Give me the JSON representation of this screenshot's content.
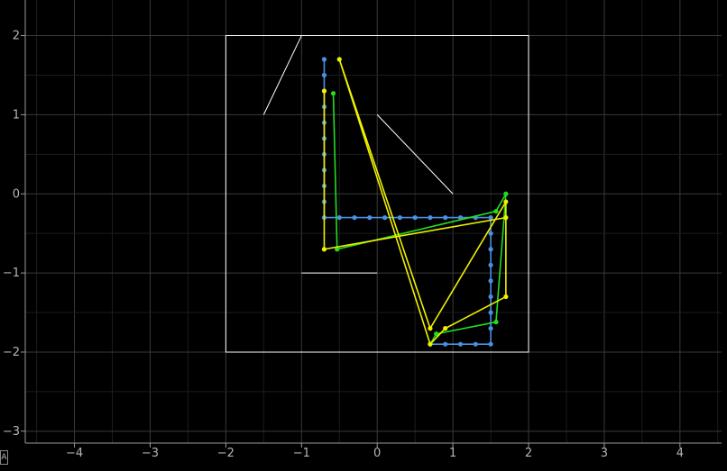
{
  "chart_data": {
    "type": "scatter",
    "title": "",
    "xlabel": "",
    "ylabel": "",
    "xlim": [
      -4.65,
      4.55
    ],
    "ylim": [
      -3.15,
      2.45
    ],
    "grid": true,
    "x_ticks": [
      -4,
      -3,
      -2,
      -1,
      0,
      1,
      2,
      3,
      4
    ],
    "y_ticks": [
      -3,
      -2,
      -1,
      0,
      1,
      2
    ],
    "x_tick_labels": [
      "−4",
      "−3",
      "−2",
      "−1",
      "0",
      "1",
      "2",
      "3",
      "4"
    ],
    "y_tick_labels": [
      "−3",
      "−2",
      "−1",
      "0",
      "1",
      "2"
    ],
    "shapes": [
      {
        "points": [
          [
            -2,
            2
          ],
          [
            2,
            2
          ],
          [
            2,
            -2
          ],
          [
            -2,
            -2
          ]
        ],
        "closed": true,
        "color": "#ffffff"
      }
    ],
    "segments": [
      {
        "points": [
          [
            -1.5,
            1.0
          ],
          [
            -1.0,
            2.0
          ]
        ],
        "color": "#ffffff"
      },
      {
        "points": [
          [
            0,
            1.0
          ],
          [
            1.0,
            0
          ]
        ],
        "color": "#ffffff"
      },
      {
        "points": [
          [
            -1.0,
            -1.0
          ],
          [
            0,
            -1.0
          ]
        ],
        "color": "#ffffff"
      }
    ],
    "series": [
      {
        "color": "#4a90e2",
        "line_points": [
          [
            -0.7,
            1.7
          ],
          [
            -0.7,
            -0.3
          ],
          [
            1.5,
            -0.3
          ],
          [
            1.5,
            -1.9
          ],
          [
            0.7,
            -1.9
          ]
        ],
        "markers": [
          [
            -0.7,
            1.7
          ],
          [
            -0.7,
            1.5
          ],
          [
            -0.7,
            1.3
          ],
          [
            -0.7,
            1.1
          ],
          [
            -0.7,
            0.9
          ],
          [
            -0.7,
            0.7
          ],
          [
            -0.7,
            0.5
          ],
          [
            -0.7,
            0.3
          ],
          [
            -0.7,
            0.1
          ],
          [
            -0.7,
            -0.1
          ],
          [
            -0.7,
            -0.3
          ],
          [
            -0.5,
            -0.3
          ],
          [
            -0.3,
            -0.3
          ],
          [
            -0.1,
            -0.3
          ],
          [
            0.1,
            -0.3
          ],
          [
            0.3,
            -0.3
          ],
          [
            0.5,
            -0.3
          ],
          [
            0.7,
            -0.3
          ],
          [
            0.9,
            -0.3
          ],
          [
            1.1,
            -0.3
          ],
          [
            1.3,
            -0.3
          ],
          [
            1.5,
            -0.3
          ],
          [
            1.5,
            -0.5
          ],
          [
            1.5,
            -0.7
          ],
          [
            1.5,
            -0.9
          ],
          [
            1.5,
            -1.1
          ],
          [
            1.5,
            -1.3
          ],
          [
            1.5,
            -1.5
          ],
          [
            1.5,
            -1.7
          ],
          [
            1.5,
            -1.9
          ],
          [
            1.3,
            -1.9
          ],
          [
            1.1,
            -1.9
          ],
          [
            0.9,
            -1.9
          ],
          [
            0.7,
            -1.9
          ]
        ]
      },
      {
        "color": "#22dd22",
        "line_points": [
          [
            -0.58,
            1.27
          ],
          [
            -0.53,
            -0.7
          ],
          [
            1.57,
            -0.22
          ],
          [
            1.7,
            0
          ],
          [
            1.57,
            -1.62
          ],
          [
            0.78,
            -1.77
          ],
          [
            0.7,
            -1.9
          ]
        ],
        "markers": [
          [
            -0.58,
            1.27
          ],
          [
            -0.53,
            -0.7
          ],
          [
            1.57,
            -0.22
          ],
          [
            1.7,
            0
          ],
          [
            1.57,
            -1.62
          ],
          [
            0.78,
            -1.77
          ],
          [
            0.7,
            -1.9
          ]
        ]
      },
      {
        "color": "#f0f000",
        "line_points": [
          [
            -0.7,
            1.3
          ],
          [
            -0.7,
            -0.7
          ],
          [
            1.7,
            -0.3
          ],
          [
            1.7,
            -0.1
          ],
          [
            0.7,
            -1.7
          ],
          [
            -0.5,
            1.7
          ],
          [
            0.7,
            -1.9
          ],
          [
            0.9,
            -1.7
          ],
          [
            1.7,
            -1.3
          ],
          [
            1.7,
            -0.1
          ]
        ],
        "markers": [
          [
            -0.7,
            1.3
          ],
          [
            -0.7,
            -0.7
          ],
          [
            1.7,
            -0.3
          ],
          [
            1.7,
            -0.1
          ],
          [
            0.7,
            -1.7
          ],
          [
            -0.5,
            1.7
          ],
          [
            0.7,
            -1.9
          ],
          [
            0.9,
            -1.7
          ],
          [
            1.7,
            -1.3
          ]
        ]
      }
    ]
  },
  "corner_icon": {
    "glyph": "A",
    "name": "autoscale-icon"
  }
}
